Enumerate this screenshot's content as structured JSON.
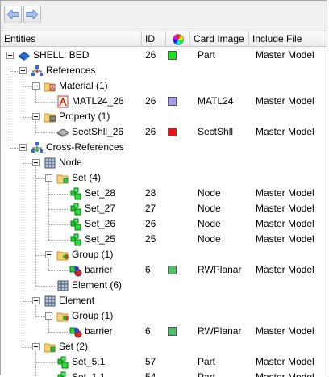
{
  "toolbar": {
    "back_icon": "arrow-left-icon",
    "forward_icon": "arrow-right-icon"
  },
  "columns": {
    "entities": "Entities",
    "id": "ID",
    "color": "color-wheel-icon",
    "card_image": "Card Image",
    "include_file": "Include File"
  },
  "colors": {
    "green": "#22dd22",
    "purple": "#a99cf0",
    "red": "#ee1111",
    "dark_green": "#4fbf6a"
  },
  "rows": [
    {
      "label": "SHELL:       BED",
      "id": "26",
      "color": "#22dd22",
      "card": "Part",
      "include": "Master Model",
      "icon": "shell-part-icon"
    },
    {
      "label": "References",
      "id": "",
      "color": "",
      "card": "",
      "include": "",
      "icon": "references-icon"
    },
    {
      "label": "Material (1)",
      "id": "",
      "color": "",
      "card": "",
      "include": "",
      "icon": "folder-material-icon"
    },
    {
      "label": "MATL24_26",
      "id": "26",
      "color": "#a99cf0",
      "card": "MATL24",
      "include": "Master Model",
      "icon": "material-icon"
    },
    {
      "label": "Property (1)",
      "id": "",
      "color": "",
      "card": "",
      "include": "",
      "icon": "folder-property-icon"
    },
    {
      "label": "SectShll_26",
      "id": "26",
      "color": "#ee1111",
      "card": "SectShll",
      "include": "Master Model",
      "icon": "property-icon"
    },
    {
      "label": "Cross-References",
      "id": "",
      "color": "",
      "card": "",
      "include": "",
      "icon": "cross-references-icon"
    },
    {
      "label": "Node",
      "id": "",
      "color": "",
      "card": "",
      "include": "",
      "icon": "node-folder-icon"
    },
    {
      "label": "Set (4)",
      "id": "",
      "color": "",
      "card": "",
      "include": "",
      "icon": "folder-set-icon"
    },
    {
      "label": "Set_28",
      "id": "28",
      "color": "",
      "card": "Node",
      "include": "Master Model",
      "icon": "set-icon"
    },
    {
      "label": "Set_27",
      "id": "27",
      "color": "",
      "card": "Node",
      "include": "Master Model",
      "icon": "set-icon"
    },
    {
      "label": "Set_26",
      "id": "26",
      "color": "",
      "card": "Node",
      "include": "Master Model",
      "icon": "set-icon"
    },
    {
      "label": "Set_25",
      "id": "25",
      "color": "",
      "card": "Node",
      "include": "Master Model",
      "icon": "set-icon"
    },
    {
      "label": "Group (1)",
      "id": "",
      "color": "",
      "card": "",
      "include": "",
      "icon": "folder-group-icon"
    },
    {
      "label": "barrier",
      "id": "6",
      "color": "#4fbf6a",
      "card": "RWPlanar",
      "include": "Master Model",
      "icon": "group-icon"
    },
    {
      "label": "Element (6)",
      "id": "",
      "color": "",
      "card": "",
      "include": "",
      "icon": "element-folder-icon"
    },
    {
      "label": "Element",
      "id": "",
      "color": "",
      "card": "",
      "include": "",
      "icon": "element-folder-icon"
    },
    {
      "label": "Group (1)",
      "id": "",
      "color": "",
      "card": "",
      "include": "",
      "icon": "folder-group-icon"
    },
    {
      "label": "barrier",
      "id": "6",
      "color": "#4fbf6a",
      "card": "RWPlanar",
      "include": "Master Model",
      "icon": "group-icon"
    },
    {
      "label": "Set (2)",
      "id": "",
      "color": "",
      "card": "",
      "include": "",
      "icon": "folder-set-icon"
    },
    {
      "label": "Set_5.1",
      "id": "57",
      "color": "",
      "card": "Part",
      "include": "Master Model",
      "icon": "set-icon"
    },
    {
      "label": "Set_1.1",
      "id": "54",
      "color": "",
      "card": "Part",
      "include": "Master Model",
      "icon": "set-icon"
    }
  ]
}
